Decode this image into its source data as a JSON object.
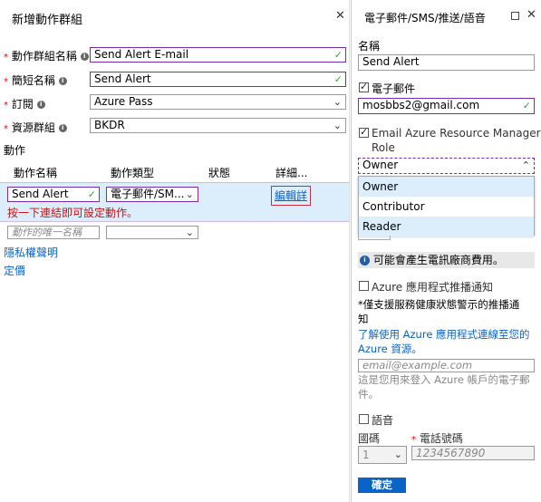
{
  "left_panel": {
    "title": "新增動作群組",
    "close_glyph": "✕",
    "fields": [
      {
        "label": "動作群組名稱",
        "value": "Send Alert E-mail"
      },
      {
        "label": "簡短名稱",
        "value": "Send Alert"
      },
      {
        "label": "訂閱",
        "value": "Azure Pass"
      },
      {
        "label": "資源群組",
        "value": "BKDR"
      }
    ],
    "actions_heading": "動作",
    "table_headers": [
      "動作名稱",
      "動作類型",
      "狀態",
      "詳細..."
    ],
    "row": {
      "name": "Send Alert",
      "type": "電子郵件/SM...",
      "details_link": "編輯詳"
    },
    "row_hint": "按一下連結即可設定動作。",
    "new_row_placeholder": "動作的唯一名稱",
    "privacy_link": "隱私權聲明",
    "pricing_link": "定價"
  },
  "right_panel": {
    "title": "電子郵件/SMS/推送/語音",
    "name_label": "名稱",
    "name_value": "Send Alert",
    "email_checkbox_label": "電子郵件",
    "email_checked": true,
    "email_value": "mosbbs2@gmail.com",
    "arm_checkbox_label_line1": "Email Azure Resource Manager",
    "arm_checkbox_label_line2": "Role",
    "arm_checked": true,
    "role_selected": "Owner",
    "role_options": [
      "Owner",
      "Contributor",
      "Reader"
    ],
    "sms_cost_notice": "可能會產生電訊廠商費用。",
    "push_label": "Azure 應用程式推播通知",
    "push_checked": false,
    "push_note_line1": "*僅支援服務健康狀態警示的推播通",
    "push_note_line2": "知",
    "push_link_line1": "了解使用 Azure 應用程式連線至您的",
    "push_link_line2": "Azure 資源。",
    "push_email_placeholder": "email@example.com",
    "push_email_help_line1": "這是您用來登入 Azure 帳戶的電子郵",
    "push_email_help_line2": "件。",
    "voice_label": "語音",
    "voice_checked": false,
    "country_code_label": "國碼",
    "country_code_value": "1",
    "phone_label": "電話號碼",
    "phone_placeholder": "1234567890",
    "ok_button": "確定"
  },
  "colors": {
    "accent_purple": "#7a2ba5",
    "link_blue": "#0a64c8",
    "button_blue": "#0a64c8",
    "row_highlight": "#dceefb",
    "required_red": "#e00000"
  }
}
